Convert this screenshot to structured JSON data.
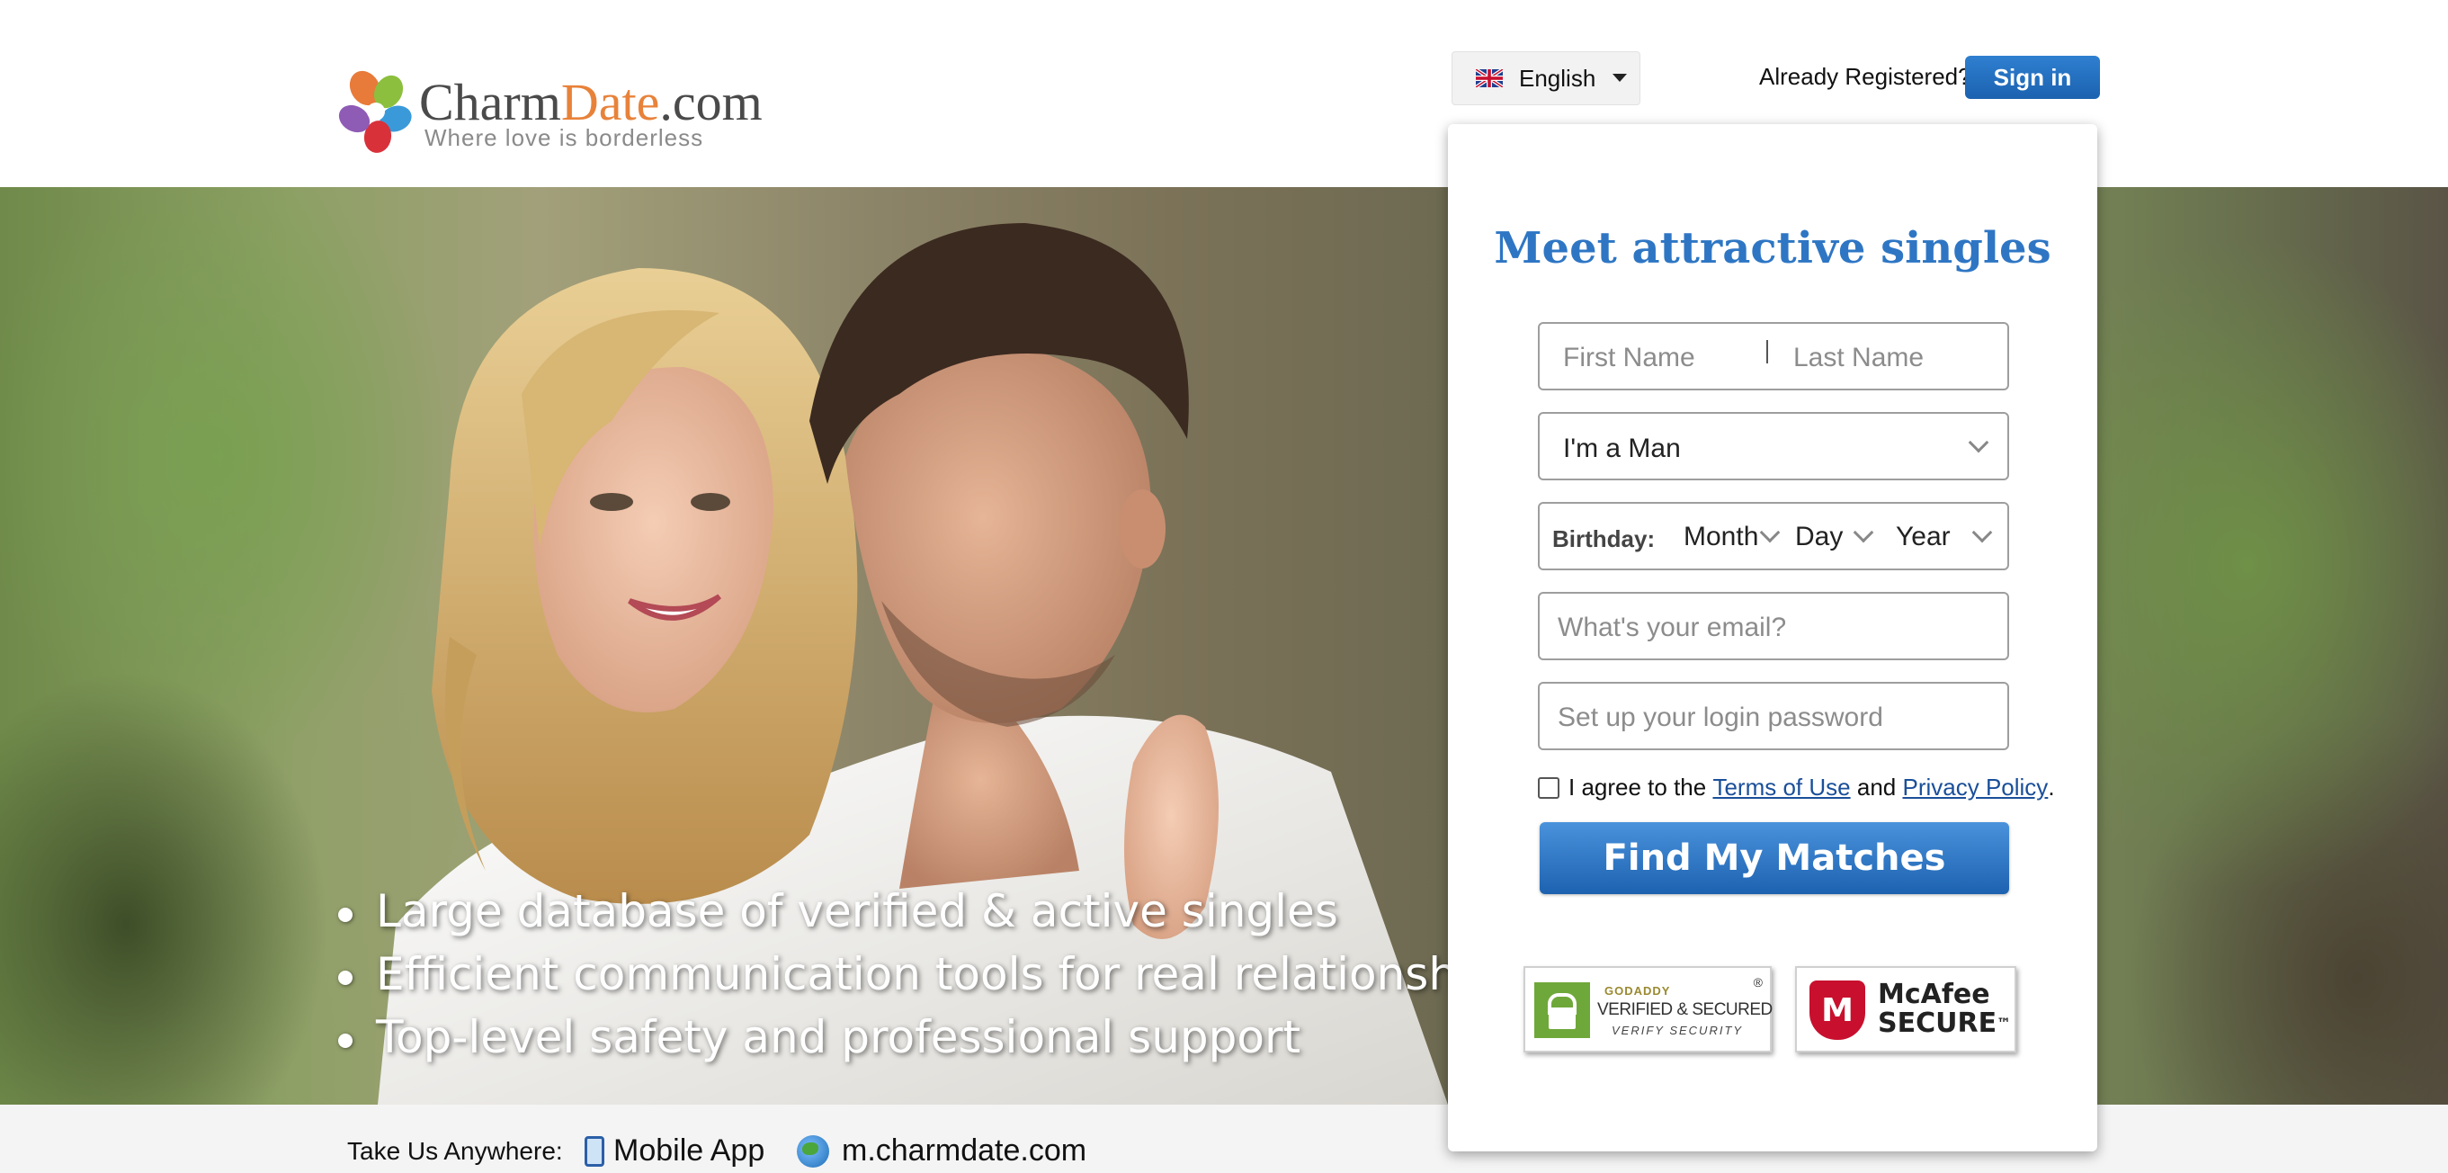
{
  "header": {
    "logo": {
      "brand_part1": "Charm",
      "brand_part2": "Date",
      "brand_part3": ".com",
      "tagline": "Where love is borderless"
    },
    "language": {
      "selected": "English",
      "flag_icon": "uk-flag-icon"
    },
    "already_registered": "Already Registered?",
    "sign_in_label": "Sign in"
  },
  "hero": {
    "bullets": [
      "Large database of verified & active singles",
      "Efficient communication tools for real relationships",
      "Top-level safety and professional support"
    ]
  },
  "signup": {
    "title": "Meet attractive singles",
    "first_name_placeholder": "First Name",
    "last_name_placeholder": "Last Name",
    "gender_value": "I'm a Man",
    "birthday_label": "Birthday:",
    "birthday_month": "Month",
    "birthday_day": "Day",
    "birthday_year": "Year",
    "email_placeholder": "What's your email?",
    "password_placeholder": "Set up your login password",
    "agree_prefix": "I agree to the",
    "terms_link": "Terms of Use",
    "agree_and": "and",
    "privacy_link": "Privacy Policy",
    "agree_suffix": ".",
    "submit_label": "Find My Matches"
  },
  "badges": {
    "godaddy_top": "GODADDY",
    "godaddy_main": "VERIFIED & SECURED",
    "godaddy_sub": "VERIFY SECURITY",
    "godaddy_reg": "®",
    "mcafee_line1": "McAfee",
    "mcafee_line2": "SECURE",
    "mcafee_tm": "™"
  },
  "footer": {
    "take_us": "Take Us Anywhere:",
    "mobile_app": "Mobile App",
    "mobile_site": "m.charmdate.com"
  },
  "colors": {
    "primary_blue": "#1b62b0",
    "title_blue": "#2e76c4",
    "link_blue": "#1a4f9a",
    "brand_orange": "#e8823a"
  }
}
